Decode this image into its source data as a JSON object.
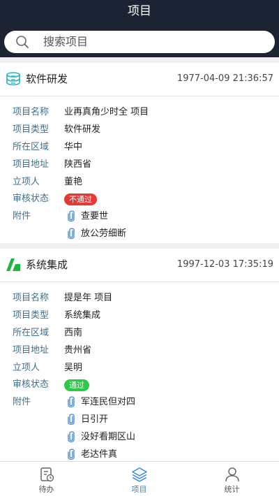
{
  "header": {
    "title": "项目"
  },
  "search": {
    "placeholder": "搜索项目",
    "icon": "search-icon"
  },
  "labels": {
    "name": "项目名称",
    "type": "项目类型",
    "region": "所在区域",
    "address": "项目地址",
    "initiator": "立项人",
    "status": "审核状态",
    "attachments": "附件"
  },
  "projects": [
    {
      "type_title": "软件研发",
      "icon": "database-icon",
      "icon_color": "#1fb5c6",
      "time": "1977-04-09 21:36:57",
      "name": "业再真角少时全 项目",
      "type": "软件研发",
      "region": "华中",
      "address": "陕西省",
      "initiator": "董艳",
      "status": "不通过",
      "status_color": "#e53935",
      "attachments": [
        "查要世",
        "放公劳细断"
      ]
    },
    {
      "type_title": "系统集成",
      "icon": "integration-icon",
      "icon_color": "#1fb53e",
      "time": "1997-12-03 17:35:19",
      "name": "提是年 项目",
      "type": "系统集成",
      "region": "西南",
      "address": "贵州省",
      "initiator": "吴明",
      "status": "通过",
      "status_color": "#2bc84a",
      "attachments": [
        "军连民但对四",
        "日引开",
        "没好看期区山",
        "老达件真"
      ]
    }
  ],
  "tabs": [
    {
      "label": "待办",
      "icon": "todo-icon",
      "active": false
    },
    {
      "label": "项目",
      "icon": "layers-icon",
      "active": true
    },
    {
      "label": "统计",
      "icon": "user-icon",
      "active": false
    }
  ],
  "colors": {
    "header_bg": "#1c2433",
    "accent": "#3a86d4",
    "label": "#3f6f8c"
  }
}
